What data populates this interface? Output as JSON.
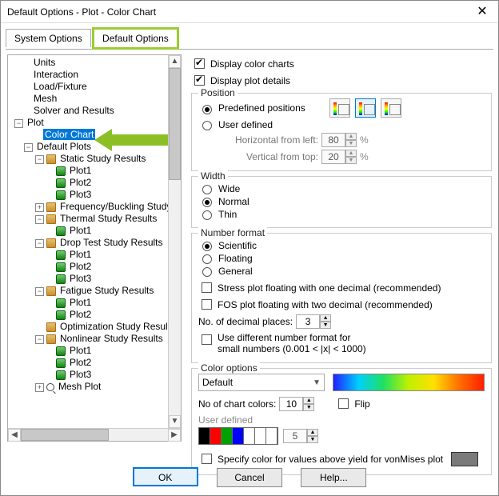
{
  "title": "Default Options - Plot - Color Chart",
  "tabs": {
    "system": "System Options",
    "default": "Default Options"
  },
  "tree": {
    "units": "Units",
    "interaction": "Interaction",
    "load": "Load/Fixture",
    "mesh": "Mesh",
    "solver": "Solver and Results",
    "plot": "Plot",
    "colorchart": "Color Chart",
    "defaultplots": "Default Plots",
    "static": "Static Study Results",
    "freq": "Frequency/Buckling Study Results",
    "thermal": "Thermal Study Results",
    "drop": "Drop Test Study Results",
    "fatigue": "Fatigue Study Results",
    "optim": "Optimization Study Results",
    "nonlin": "Nonlinear Study Results",
    "meshplot": "Mesh Plot",
    "plot1": "Plot1",
    "plot2": "Plot2",
    "plot3": "Plot3"
  },
  "top": {
    "display_color_charts": "Display color charts",
    "display_plot_details": "Display plot details"
  },
  "position": {
    "legend": "Position",
    "predefined": "Predefined positions",
    "userdef": "User defined",
    "horiz_label": "Horizontal from left:",
    "horiz_val": "80",
    "vert_label": "Vertical from top:",
    "vert_val": "20",
    "pct": "%"
  },
  "width": {
    "legend": "Width",
    "wide": "Wide",
    "normal": "Normal",
    "thin": "Thin"
  },
  "num": {
    "legend": "Number format",
    "sci": "Scientific",
    "flt": "Floating",
    "gen": "General",
    "stress": "Stress plot floating with one decimal (recommended)",
    "fos": "FOS plot floating with two decimal (recommended)",
    "places_label": "No. of decimal places:",
    "places_val": "3",
    "diff_l1": "Use different number format for",
    "diff_l2": "small numbers (0.001 < |x| < 1000)"
  },
  "color": {
    "legend": "Color options",
    "default": "Default",
    "ncolors_label": "No of chart colors:",
    "ncolors_val": "10",
    "flip": "Flip",
    "userdef": "User defined",
    "ud_val": "5",
    "spec_yield": "Specify color for values above yield for vonMises plot"
  },
  "buttons": {
    "ok": "OK",
    "cancel": "Cancel",
    "help": "Help..."
  },
  "swatch_colors": [
    "#000000",
    "#ff0000",
    "#00a000",
    "#0000ff",
    "#ffffff",
    "#ffffff",
    "#ffffff"
  ]
}
